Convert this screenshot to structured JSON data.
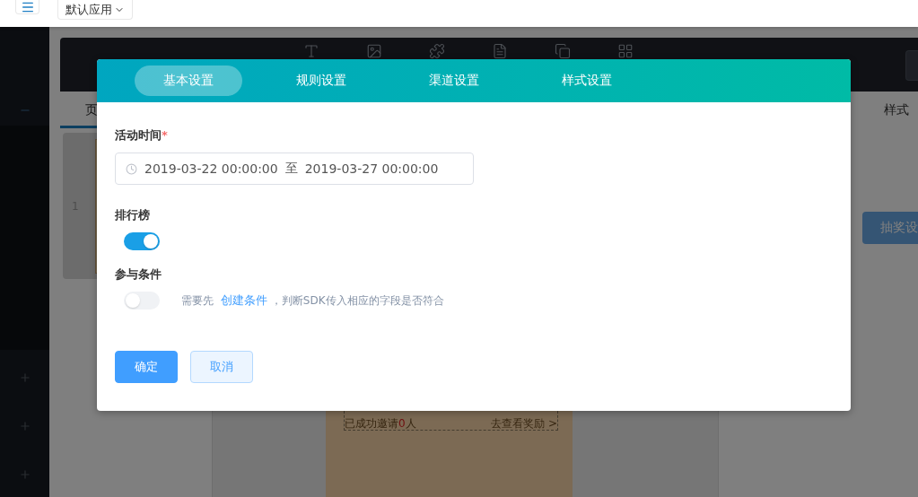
{
  "top_bar": {
    "app_selector": "默认应用"
  },
  "editor": {
    "left_tab": "页",
    "page_number": "1",
    "right_tab": "样式",
    "right_button": "抽奖设",
    "preview": {
      "invite_prefix": "已成功邀请",
      "invite_count": "0",
      "invite_suffix": "人",
      "rewards_link": "去查看奖励 >"
    }
  },
  "dialog": {
    "tabs": [
      {
        "label": "基本设置",
        "selected": true
      },
      {
        "label": "规则设置",
        "selected": false
      },
      {
        "label": "渠道设置",
        "selected": false
      },
      {
        "label": "样式设置",
        "selected": false
      }
    ],
    "fields": [
      {
        "kind": "daterange",
        "label": "活动时间",
        "required_mark": "*",
        "start": "2019-03-22 00:00:00",
        "separator": "至",
        "end": "2019-03-27 00:00:00"
      },
      {
        "kind": "switch",
        "label": "排行榜",
        "on": true
      },
      {
        "kind": "switch",
        "label": "参与条件",
        "on": false,
        "hint_prefix": "需要先",
        "hint_link": "创建条件",
        "hint_suffix": "，判断SDK传入相应的字段是否符合"
      }
    ],
    "buttons": [
      {
        "label": "确定",
        "kind": "primary"
      },
      {
        "label": "取消",
        "kind": "secondary"
      }
    ]
  }
}
